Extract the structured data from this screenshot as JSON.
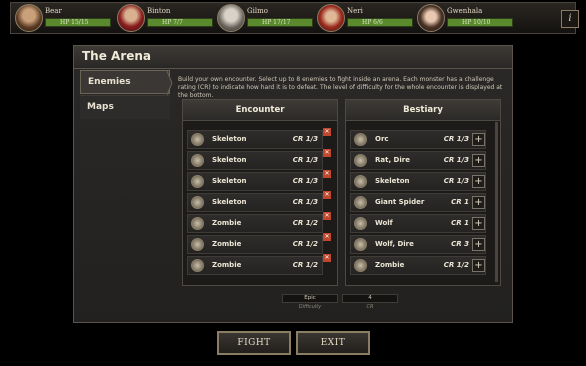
{
  "party": [
    {
      "name": "Bear",
      "hp": "HP 15/15"
    },
    {
      "name": "Binton",
      "hp": "HP 7/7"
    },
    {
      "name": "Gilmo",
      "hp": "HP 17/17"
    },
    {
      "name": "Neri",
      "hp": "HP 6/6"
    },
    {
      "name": "Gwenhala",
      "hp": "HP 10/10"
    }
  ],
  "info_label": "i",
  "panel": {
    "title": "The Arena",
    "tabs": [
      "Enemies",
      "Maps"
    ],
    "description": "Build your own encounter. Select up to 8 enemies to fight inside an arena. Each monster has a challenge rating (CR) to indicate how hard it is to defeat. The level of difficulty for the whole encounter is displayed at the bottom."
  },
  "encounter": {
    "header": "Encounter",
    "rows": [
      {
        "name": "Skeleton",
        "cr": "CR 1/3"
      },
      {
        "name": "Skeleton",
        "cr": "CR 1/3"
      },
      {
        "name": "Skeleton",
        "cr": "CR 1/3"
      },
      {
        "name": "Skeleton",
        "cr": "CR 1/3"
      },
      {
        "name": "Zombie",
        "cr": "CR 1/2"
      },
      {
        "name": "Zombie",
        "cr": "CR 1/2"
      },
      {
        "name": "Zombie",
        "cr": "CR 1/2"
      }
    ]
  },
  "bestiary": {
    "header": "Bestiary",
    "rows": [
      {
        "name": "Orc",
        "cr": "CR 1/3"
      },
      {
        "name": "Rat, Dire",
        "cr": "CR 1/3"
      },
      {
        "name": "Skeleton",
        "cr": "CR 1/3"
      },
      {
        "name": "Giant Spider",
        "cr": "CR 1"
      },
      {
        "name": "Wolf",
        "cr": "CR 1"
      },
      {
        "name": "Wolf, Dire",
        "cr": "CR 3"
      },
      {
        "name": "Zombie",
        "cr": "CR 1/2"
      }
    ]
  },
  "stats": {
    "difficulty_value": "Epic",
    "difficulty_label": "Difficulty",
    "cr_value": "4",
    "cr_label": "CR"
  },
  "actions": {
    "fight": "FIGHT",
    "exit": "EXIT"
  },
  "colors": {
    "hp_bar": "#5b8a2e",
    "remove_button": "#c0462e",
    "panel_bg": "#2b2927"
  }
}
